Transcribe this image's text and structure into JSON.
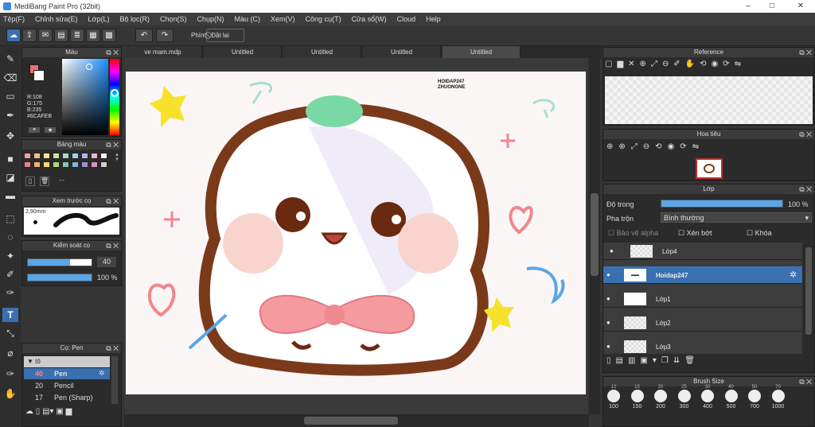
{
  "window": {
    "title": "MediBang Paint Pro (32bit)",
    "minimize": "–",
    "maximize": "□",
    "close": "✕"
  },
  "menu": [
    "Tệp(F)",
    "Chỉnh sửa(E)",
    "Lớp(L)",
    "Bộ lọc(R)",
    "Chọn(S)",
    "Chụp(N)",
    "Màu (C)",
    "Xem(V)",
    "Công cụ(T)",
    "Cửa sổ(W)",
    "Cloud",
    "Help"
  ],
  "toolbar": {
    "shortcut_label": "Phím",
    "reset_label": "Đặt lại"
  },
  "color_panel": {
    "title": "Màu",
    "r": "R:108",
    "g": "G:175",
    "b": "B:235",
    "hex": "#6CAFEB",
    "primary": "#f07070",
    "secondary": "#ffffff"
  },
  "palette_panel": {
    "title": "Bảng màu",
    "colors": [
      "#f4a09a",
      "#f6c090",
      "#fbe49a",
      "#c8e6a0",
      "#a8d8c8",
      "#a4cde6",
      "#b8b0e6",
      "#e8b0d8",
      "#f4f4f4",
      "#f08080",
      "#f4b070",
      "#f8d870",
      "#a8d880",
      "#80c8b0",
      "#80b8e0",
      "#a090d8",
      "#d890c8",
      "#d0d0d0"
    ],
    "more": "---"
  },
  "preview_panel": {
    "title": "Xem trước cọ",
    "size": "2,90mm"
  },
  "control_panel": {
    "title": "Kiểm soát cọ",
    "size_value": "40",
    "opacity_value": "100 %"
  },
  "brush_panel": {
    "title": "Cọ: Pen",
    "group": "tô",
    "brushes": [
      {
        "size": "40",
        "name": "Pen"
      },
      {
        "size": "20",
        "name": "Pencil"
      },
      {
        "size": "17",
        "name": "Pen (Sharp)"
      }
    ]
  },
  "tabs": [
    "ve mam.mdp",
    "Untitled",
    "Untitled",
    "Untitled",
    "Untitled"
  ],
  "canvas": {
    "watermark_line1": "HOIDAP247",
    "watermark_line2": "ZHUONGNE"
  },
  "reference_panel": {
    "title": "Reference"
  },
  "navigator_panel": {
    "title": "Hoa tiêu"
  },
  "layer_panel": {
    "title": "Lớp",
    "opacity_label": "Độ trong",
    "opacity_value": "100 %",
    "blend_label": "Pha trộn",
    "blend_value": "Bình thường",
    "protect_alpha": "Bảo vệ alpha",
    "clipping": "Xén bớt",
    "lock": "Khóa",
    "layers": [
      {
        "name": "Lớp4"
      },
      {
        "name": "Hoidap247"
      },
      {
        "name": "Lớp1"
      },
      {
        "name": "Lớp2"
      },
      {
        "name": "Lớp3"
      }
    ]
  },
  "brushsize_panel": {
    "title": "Brush Size",
    "top": [
      "12",
      "15",
      "20",
      "25",
      "30",
      "40",
      "50",
      "70"
    ],
    "sizes": [
      "100",
      "150",
      "200",
      "300",
      "400",
      "500",
      "700",
      "1000"
    ]
  }
}
